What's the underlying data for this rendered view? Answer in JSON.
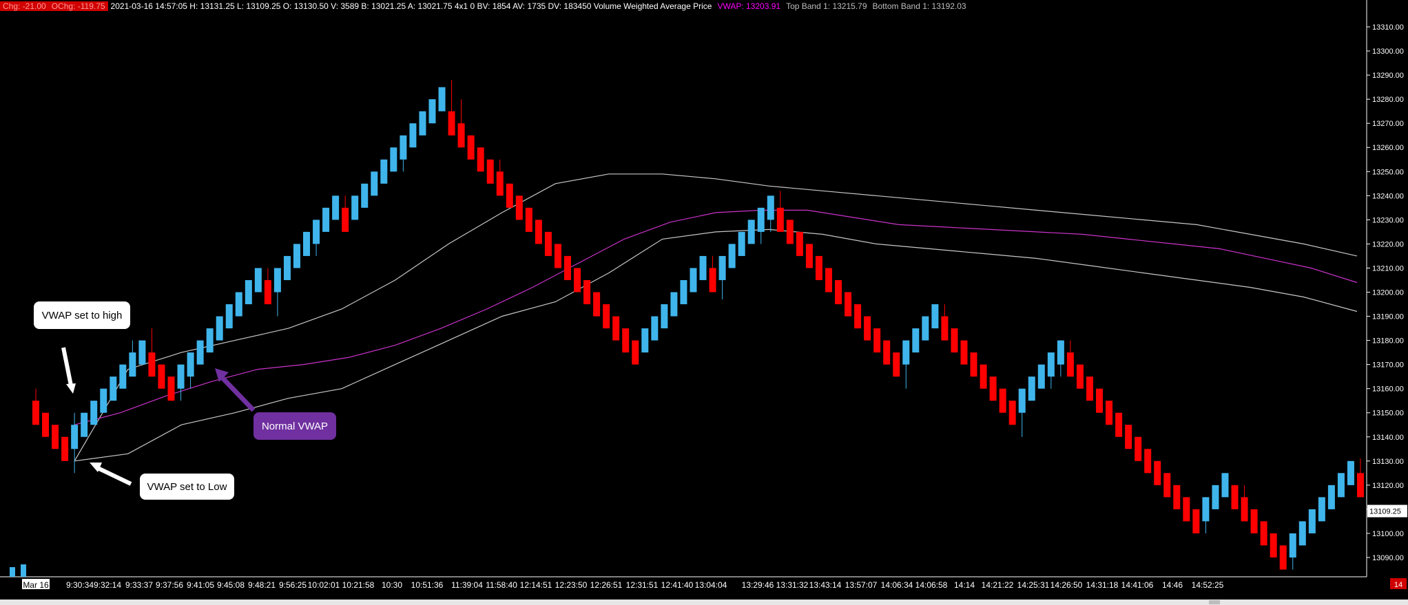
{
  "header": {
    "chg": "Chg: -21.00",
    "ochg": "OChg: -119.75",
    "info": "2021-03-16 14:57:05 H: 13131.25 L: 13109.25 O: 13130.50 V: 3589 B: 13021.25 A: 13021.75 4x1 0 BV: 1854 AV: 1735 DV: 183450 Volume Weighted Average Price",
    "vwap": "VWAP: 13203.91",
    "top_band": "Top Band 1: 13215.79",
    "bottom_band": "Bottom Band 1: 13192.03"
  },
  "colors": {
    "up": "#3fb5ec",
    "down": "#ff0000",
    "vwap": "#cc33cc",
    "band": "#c8c8c8",
    "axis": "#ffffff"
  },
  "annotations": {
    "vwap_high": "VWAP set to high",
    "normal_vwap": "Normal VWAP",
    "vwap_low": "VWAP set to Low"
  },
  "price_marker": "13109.25",
  "corner_badge": "14",
  "chart_data": {
    "type": "candlestick",
    "ylim": [
      13082,
      13316
    ],
    "y_ticks": [
      13090,
      13100,
      13110,
      13120,
      13130,
      13140,
      13150,
      13160,
      13170,
      13180,
      13190,
      13200,
      13210,
      13220,
      13230,
      13240,
      13250,
      13260,
      13270,
      13280,
      13290,
      13300,
      13310
    ],
    "x_labels": [
      "Mar 16",
      "9:30:34",
      "9:32:14",
      "9:33:37",
      "9:37:56",
      "9:41:05",
      "9:45:08",
      "9:48:21",
      "9:56:25",
      "10:02:01",
      "10:21:58",
      "10:30",
      "10:51:36",
      "11:39:04",
      "11:58:40",
      "12:14:51",
      "12:23:50",
      "12:26:51",
      "12:31:51",
      "12:41:40",
      "13:04:04",
      "13:29:46",
      "13:31:32",
      "13:43:14",
      "13:57:07",
      "14:06:34",
      "14:06:58",
      "14:14",
      "14:21:22",
      "14:25:31",
      "14:26:50",
      "14:31:18",
      "14:41:06",
      "14:46",
      "14:52:25"
    ],
    "candles": [
      {
        "o": 13155,
        "c": 13145,
        "h": 13160,
        "l": 13145
      },
      {
        "o": 13150,
        "c": 13140,
        "h": 13150,
        "l": 13140
      },
      {
        "o": 13145,
        "c": 13135,
        "h": 13145,
        "l": 13135
      },
      {
        "o": 13140,
        "c": 13130,
        "h": 13140,
        "l": 13130
      },
      {
        "o": 13135,
        "c": 13145,
        "h": 13150,
        "l": 13125
      },
      {
        "o": 13140,
        "c": 13150,
        "h": 13150,
        "l": 13140
      },
      {
        "o": 13145,
        "c": 13155,
        "h": 13155,
        "l": 13145
      },
      {
        "o": 13150,
        "c": 13160,
        "h": 13160,
        "l": 13150
      },
      {
        "o": 13155,
        "c": 13165,
        "h": 13165,
        "l": 13155
      },
      {
        "o": 13160,
        "c": 13170,
        "h": 13170,
        "l": 13160
      },
      {
        "o": 13165,
        "c": 13175,
        "h": 13180,
        "l": 13165
      },
      {
        "o": 13170,
        "c": 13180,
        "h": 13180,
        "l": 13170
      },
      {
        "o": 13175,
        "c": 13165,
        "h": 13185,
        "l": 13165
      },
      {
        "o": 13170,
        "c": 13160,
        "h": 13170,
        "l": 13160
      },
      {
        "o": 13165,
        "c": 13155,
        "h": 13165,
        "l": 13155
      },
      {
        "o": 13160,
        "c": 13170,
        "h": 13170,
        "l": 13155
      },
      {
        "o": 13165,
        "c": 13175,
        "h": 13175,
        "l": 13160
      },
      {
        "o": 13170,
        "c": 13180,
        "h": 13180,
        "l": 13170
      },
      {
        "o": 13175,
        "c": 13185,
        "h": 13185,
        "l": 13175
      },
      {
        "o": 13180,
        "c": 13190,
        "h": 13190,
        "l": 13180
      },
      {
        "o": 13185,
        "c": 13195,
        "h": 13195,
        "l": 13185
      },
      {
        "o": 13190,
        "c": 13200,
        "h": 13200,
        "l": 13190
      },
      {
        "o": 13195,
        "c": 13205,
        "h": 13205,
        "l": 13195
      },
      {
        "o": 13200,
        "c": 13210,
        "h": 13210,
        "l": 13200
      },
      {
        "o": 13205,
        "c": 13195,
        "h": 13210,
        "l": 13195
      },
      {
        "o": 13200,
        "c": 13210,
        "h": 13210,
        "l": 13190
      },
      {
        "o": 13205,
        "c": 13215,
        "h": 13215,
        "l": 13205
      },
      {
        "o": 13210,
        "c": 13220,
        "h": 13220,
        "l": 13210
      },
      {
        "o": 13215,
        "c": 13225,
        "h": 13225,
        "l": 13215
      },
      {
        "o": 13220,
        "c": 13230,
        "h": 13230,
        "l": 13215
      },
      {
        "o": 13225,
        "c": 13235,
        "h": 13235,
        "l": 13225
      },
      {
        "o": 13230,
        "c": 13240,
        "h": 13240,
        "l": 13230
      },
      {
        "o": 13235,
        "c": 13225,
        "h": 13240,
        "l": 13225
      },
      {
        "o": 13230,
        "c": 13240,
        "h": 13240,
        "l": 13230
      },
      {
        "o": 13235,
        "c": 13245,
        "h": 13245,
        "l": 13235
      },
      {
        "o": 13240,
        "c": 13250,
        "h": 13250,
        "l": 13240
      },
      {
        "o": 13245,
        "c": 13255,
        "h": 13255,
        "l": 13245
      },
      {
        "o": 13250,
        "c": 13260,
        "h": 13260,
        "l": 13250
      },
      {
        "o": 13255,
        "c": 13265,
        "h": 13265,
        "l": 13250
      },
      {
        "o": 13260,
        "c": 13270,
        "h": 13270,
        "l": 13260
      },
      {
        "o": 13265,
        "c": 13275,
        "h": 13275,
        "l": 13265
      },
      {
        "o": 13270,
        "c": 13280,
        "h": 13280,
        "l": 13270
      },
      {
        "o": 13275,
        "c": 13285,
        "h": 13285,
        "l": 13275
      },
      {
        "o": 13275,
        "c": 13265,
        "h": 13288,
        "l": 13265
      },
      {
        "o": 13270,
        "c": 13260,
        "h": 13280,
        "l": 13260
      },
      {
        "o": 13265,
        "c": 13255,
        "h": 13265,
        "l": 13255
      },
      {
        "o": 13260,
        "c": 13250,
        "h": 13260,
        "l": 13250
      },
      {
        "o": 13255,
        "c": 13245,
        "h": 13255,
        "l": 13245
      },
      {
        "o": 13250,
        "c": 13240,
        "h": 13255,
        "l": 13240
      },
      {
        "o": 13245,
        "c": 13235,
        "h": 13245,
        "l": 13235
      },
      {
        "o": 13240,
        "c": 13230,
        "h": 13240,
        "l": 13230
      },
      {
        "o": 13235,
        "c": 13225,
        "h": 13235,
        "l": 13225
      },
      {
        "o": 13230,
        "c": 13220,
        "h": 13230,
        "l": 13220
      },
      {
        "o": 13225,
        "c": 13215,
        "h": 13225,
        "l": 13215
      },
      {
        "o": 13220,
        "c": 13210,
        "h": 13220,
        "l": 13210
      },
      {
        "o": 13215,
        "c": 13205,
        "h": 13215,
        "l": 13205
      },
      {
        "o": 13210,
        "c": 13200,
        "h": 13210,
        "l": 13200
      },
      {
        "o": 13205,
        "c": 13195,
        "h": 13205,
        "l": 13195
      },
      {
        "o": 13200,
        "c": 13190,
        "h": 13200,
        "l": 13190
      },
      {
        "o": 13195,
        "c": 13185,
        "h": 13195,
        "l": 13185
      },
      {
        "o": 13190,
        "c": 13180,
        "h": 13190,
        "l": 13180
      },
      {
        "o": 13185,
        "c": 13175,
        "h": 13185,
        "l": 13175
      },
      {
        "o": 13180,
        "c": 13170,
        "h": 13180,
        "l": 13170
      },
      {
        "o": 13175,
        "c": 13185,
        "h": 13185,
        "l": 13175
      },
      {
        "o": 13180,
        "c": 13190,
        "h": 13190,
        "l": 13180
      },
      {
        "o": 13185,
        "c": 13195,
        "h": 13195,
        "l": 13185
      },
      {
        "o": 13190,
        "c": 13200,
        "h": 13200,
        "l": 13190
      },
      {
        "o": 13195,
        "c": 13205,
        "h": 13205,
        "l": 13195
      },
      {
        "o": 13200,
        "c": 13210,
        "h": 13210,
        "l": 13200
      },
      {
        "o": 13205,
        "c": 13215,
        "h": 13215,
        "l": 13205
      },
      {
        "o": 13210,
        "c": 13200,
        "h": 13215,
        "l": 13200
      },
      {
        "o": 13205,
        "c": 13215,
        "h": 13215,
        "l": 13197
      },
      {
        "o": 13210,
        "c": 13220,
        "h": 13220,
        "l": 13210
      },
      {
        "o": 13215,
        "c": 13225,
        "h": 13225,
        "l": 13215
      },
      {
        "o": 13220,
        "c": 13230,
        "h": 13230,
        "l": 13220
      },
      {
        "o": 13225,
        "c": 13235,
        "h": 13235,
        "l": 13220
      },
      {
        "o": 13230,
        "c": 13240,
        "h": 13240,
        "l": 13225
      },
      {
        "o": 13235,
        "c": 13225,
        "h": 13242,
        "l": 13225
      },
      {
        "o": 13230,
        "c": 13220,
        "h": 13230,
        "l": 13220
      },
      {
        "o": 13225,
        "c": 13215,
        "h": 13225,
        "l": 13215
      },
      {
        "o": 13220,
        "c": 13210,
        "h": 13220,
        "l": 13210
      },
      {
        "o": 13215,
        "c": 13205,
        "h": 13215,
        "l": 13205
      },
      {
        "o": 13210,
        "c": 13200,
        "h": 13210,
        "l": 13200
      },
      {
        "o": 13205,
        "c": 13195,
        "h": 13205,
        "l": 13195
      },
      {
        "o": 13200,
        "c": 13190,
        "h": 13200,
        "l": 13190
      },
      {
        "o": 13195,
        "c": 13185,
        "h": 13195,
        "l": 13185
      },
      {
        "o": 13190,
        "c": 13180,
        "h": 13190,
        "l": 13180
      },
      {
        "o": 13185,
        "c": 13175,
        "h": 13185,
        "l": 13175
      },
      {
        "o": 13180,
        "c": 13170,
        "h": 13180,
        "l": 13170
      },
      {
        "o": 13175,
        "c": 13165,
        "h": 13175,
        "l": 13165
      },
      {
        "o": 13170,
        "c": 13180,
        "h": 13180,
        "l": 13160
      },
      {
        "o": 13175,
        "c": 13185,
        "h": 13185,
        "l": 13175
      },
      {
        "o": 13180,
        "c": 13190,
        "h": 13190,
        "l": 13180
      },
      {
        "o": 13185,
        "c": 13195,
        "h": 13195,
        "l": 13185
      },
      {
        "o": 13190,
        "c": 13180,
        "h": 13195,
        "l": 13180
      },
      {
        "o": 13185,
        "c": 13175,
        "h": 13185,
        "l": 13175
      },
      {
        "o": 13180,
        "c": 13170,
        "h": 13180,
        "l": 13170
      },
      {
        "o": 13175,
        "c": 13165,
        "h": 13175,
        "l": 13165
      },
      {
        "o": 13170,
        "c": 13160,
        "h": 13170,
        "l": 13160
      },
      {
        "o": 13165,
        "c": 13155,
        "h": 13165,
        "l": 13155
      },
      {
        "o": 13160,
        "c": 13150,
        "h": 13160,
        "l": 13150
      },
      {
        "o": 13155,
        "c": 13145,
        "h": 13155,
        "l": 13145
      },
      {
        "o": 13150,
        "c": 13160,
        "h": 13160,
        "l": 13140
      },
      {
        "o": 13155,
        "c": 13165,
        "h": 13165,
        "l": 13155
      },
      {
        "o": 13160,
        "c": 13170,
        "h": 13170,
        "l": 13160
      },
      {
        "o": 13165,
        "c": 13175,
        "h": 13175,
        "l": 13160
      },
      {
        "o": 13170,
        "c": 13180,
        "h": 13180,
        "l": 13165
      },
      {
        "o": 13175,
        "c": 13165,
        "h": 13180,
        "l": 13165
      },
      {
        "o": 13170,
        "c": 13160,
        "h": 13170,
        "l": 13160
      },
      {
        "o": 13165,
        "c": 13155,
        "h": 13165,
        "l": 13155
      },
      {
        "o": 13160,
        "c": 13150,
        "h": 13160,
        "l": 13150
      },
      {
        "o": 13155,
        "c": 13145,
        "h": 13155,
        "l": 13145
      },
      {
        "o": 13150,
        "c": 13140,
        "h": 13150,
        "l": 13140
      },
      {
        "o": 13145,
        "c": 13135,
        "h": 13145,
        "l": 13135
      },
      {
        "o": 13140,
        "c": 13130,
        "h": 13140,
        "l": 13130
      },
      {
        "o": 13135,
        "c": 13125,
        "h": 13135,
        "l": 13125
      },
      {
        "o": 13130,
        "c": 13120,
        "h": 13130,
        "l": 13120
      },
      {
        "o": 13125,
        "c": 13115,
        "h": 13125,
        "l": 13115
      },
      {
        "o": 13120,
        "c": 13110,
        "h": 13120,
        "l": 13110
      },
      {
        "o": 13115,
        "c": 13105,
        "h": 13115,
        "l": 13105
      },
      {
        "o": 13110,
        "c": 13100,
        "h": 13110,
        "l": 13100
      },
      {
        "o": 13105,
        "c": 13115,
        "h": 13115,
        "l": 13100
      },
      {
        "o": 13110,
        "c": 13120,
        "h": 13120,
        "l": 13110
      },
      {
        "o": 13115,
        "c": 13125,
        "h": 13125,
        "l": 13115
      },
      {
        "o": 13120,
        "c": 13110,
        "h": 13120,
        "l": 13110
      },
      {
        "o": 13115,
        "c": 13105,
        "h": 13120,
        "l": 13105
      },
      {
        "o": 13110,
        "c": 13100,
        "h": 13110,
        "l": 13100
      },
      {
        "o": 13105,
        "c": 13095,
        "h": 13105,
        "l": 13095
      },
      {
        "o": 13100,
        "c": 13090,
        "h": 13100,
        "l": 13090
      },
      {
        "o": 13095,
        "c": 13085,
        "h": 13095,
        "l": 13085
      },
      {
        "o": 13090,
        "c": 13100,
        "h": 13100,
        "l": 13085
      },
      {
        "o": 13095,
        "c": 13105,
        "h": 13105,
        "l": 13095
      },
      {
        "o": 13100,
        "c": 13110,
        "h": 13110,
        "l": 13100
      },
      {
        "o": 13105,
        "c": 13115,
        "h": 13115,
        "l": 13105
      },
      {
        "o": 13110,
        "c": 13120,
        "h": 13120,
        "l": 13110
      },
      {
        "o": 13115,
        "c": 13125,
        "h": 13125,
        "l": 13115
      },
      {
        "o": 13120,
        "c": 13130,
        "h": 13130,
        "l": 13120
      },
      {
        "o": 13125,
        "c": 13115,
        "h": 13131,
        "l": 13115
      }
    ],
    "vwap": [
      13145,
      13150,
      13157,
      13163,
      13168,
      13170,
      13173,
      13178,
      13185,
      13193,
      13202,
      13212,
      13222,
      13229,
      13233,
      13234,
      13234,
      13231,
      13228,
      13227,
      13226,
      13225,
      13224,
      13222,
      13220,
      13218,
      13214,
      13210,
      13204
    ],
    "top_band": [
      13130,
      13168,
      13175,
      13180,
      13185,
      13193,
      13205,
      13220,
      13233,
      13245,
      13249,
      13249,
      13247,
      13244,
      13242,
      13240,
      13238,
      13236,
      13234,
      13232,
      13230,
      13228,
      13224,
      13220,
      13215
    ],
    "bottom_band": [
      13130,
      13133,
      13145,
      13150,
      13156,
      13160,
      13170,
      13180,
      13190,
      13196,
      13208,
      13222,
      13225,
      13226,
      13224,
      13220,
      13218,
      13216,
      13214,
      13211,
      13208,
      13205,
      13202,
      13198,
      13192
    ]
  }
}
